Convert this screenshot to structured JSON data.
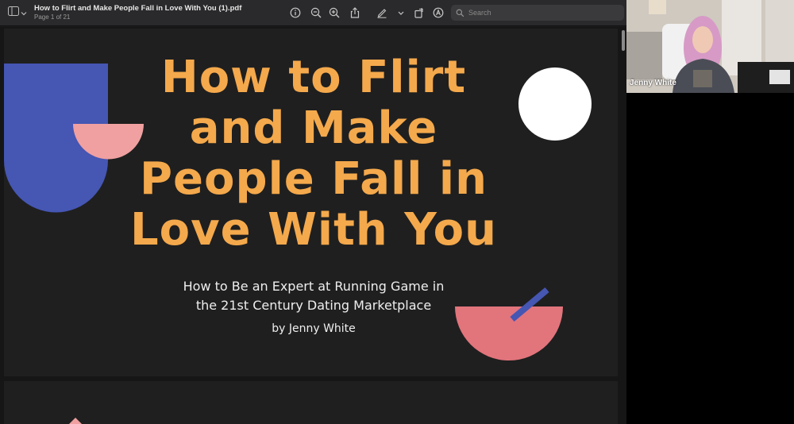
{
  "document": {
    "title": "How to Flirt and Make People Fall in Love With You (1).pdf",
    "page_info": "Page 1 of 21"
  },
  "toolbar": {
    "search_placeholder": "Search",
    "icons": [
      "sidebar-icon",
      "chevron-down-icon",
      "info-icon",
      "zoom-out-icon",
      "zoom-in-icon",
      "share-icon",
      "markup-pen-icon",
      "chevron-down-icon",
      "rotate-icon",
      "annotate-icon",
      "search-icon"
    ]
  },
  "slide": {
    "title_lines": [
      "How to Flirt",
      "and Make",
      "People Fall in",
      "Love With You"
    ],
    "subtitle_lines": [
      "How to Be an Expert at Running Game in",
      "the 21st Century Dating Marketplace"
    ],
    "author": "by Jenny White",
    "colors": {
      "background": "#1f1f1f",
      "title": "#f4a94c",
      "blue_shape": "#4556b3",
      "pink_shape": "#f0a0a0",
      "coral_shape": "#e2747c",
      "white_circle": "#ffffff"
    }
  },
  "webcam": {
    "participant_name": "Jenny White"
  }
}
